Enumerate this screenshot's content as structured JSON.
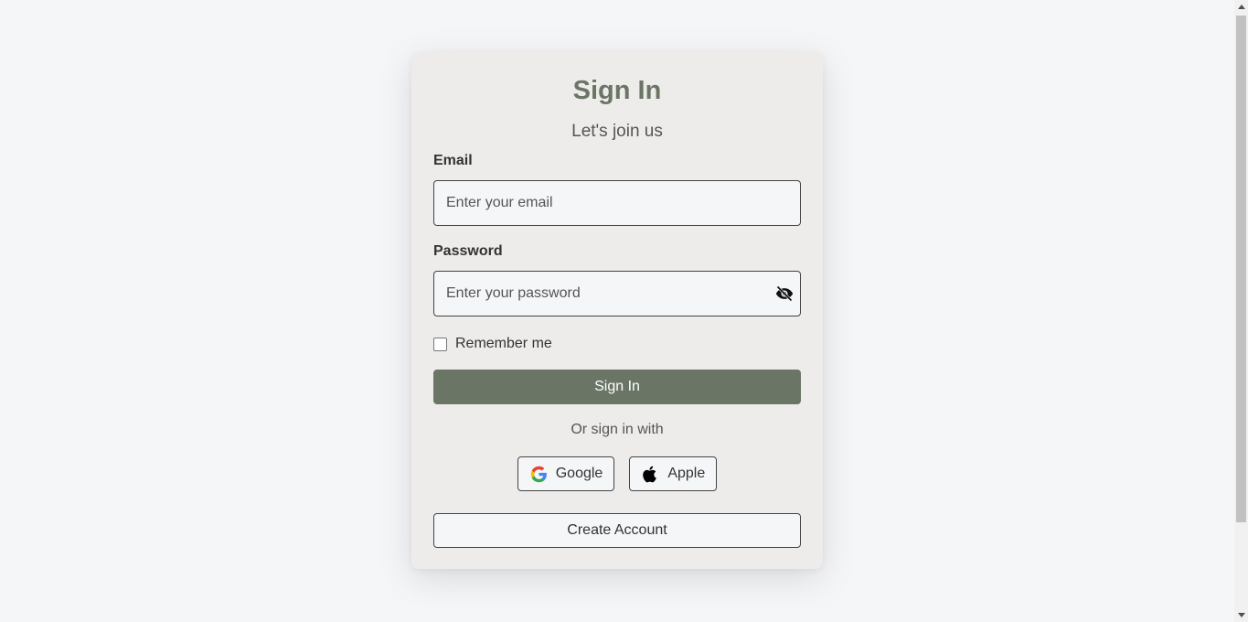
{
  "card": {
    "title": "Sign In",
    "subtitle": "Let's join us",
    "email": {
      "label": "Email",
      "placeholder": "Enter your email",
      "value": ""
    },
    "password": {
      "label": "Password",
      "placeholder": "Enter your password",
      "value": "",
      "toggle_icon": "eye-off-icon"
    },
    "remember": {
      "label": "Remember me",
      "checked": false
    },
    "signin_button": "Sign In",
    "or_text": "Or sign in with",
    "social": [
      {
        "label": "Google",
        "icon": "google-icon"
      },
      {
        "label": "Apple",
        "icon": "apple-icon"
      }
    ],
    "create_account": "Create Account"
  },
  "colors": {
    "accent": "#6b7566",
    "card_bg": "#eeecea",
    "page_bg": "#f5f6f8"
  }
}
